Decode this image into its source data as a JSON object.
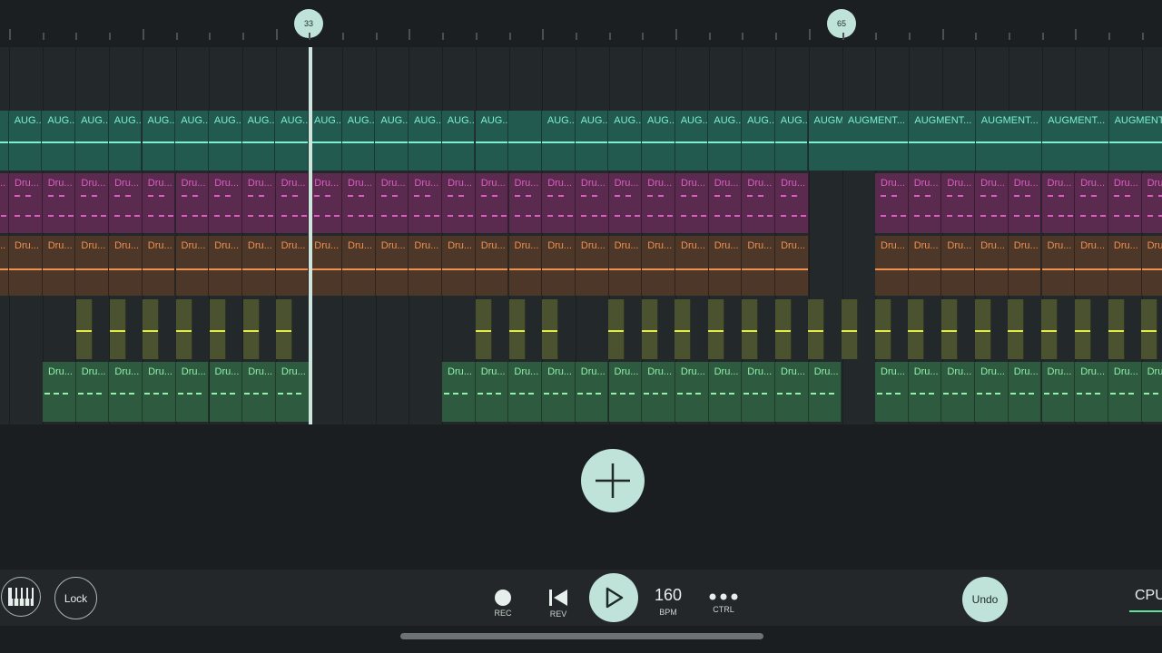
{
  "ruler": {
    "markers": [
      "33",
      "65"
    ]
  },
  "tracks": {
    "augment": {
      "short_label": "AUG...",
      "long_label": "AUGMENT...",
      "mid_label": "AUGME...",
      "first_label": "...",
      "color": "#7cf0cf"
    },
    "pink": {
      "label": "Dru...",
      "color": "#e05cc4"
    },
    "orange": {
      "label": "Dru...",
      "color": "#f0914e"
    },
    "green": {
      "label": "Dru...",
      "color": "#8ff2a8"
    }
  },
  "bottom": {
    "lock_label": "Lock",
    "rec_label": "REC",
    "rev_label": "REV",
    "bpm_value": "160",
    "bpm_label": "BPM",
    "ctrl_label": "CTRL",
    "undo_label": "Undo",
    "cpu_label": "CPU"
  }
}
